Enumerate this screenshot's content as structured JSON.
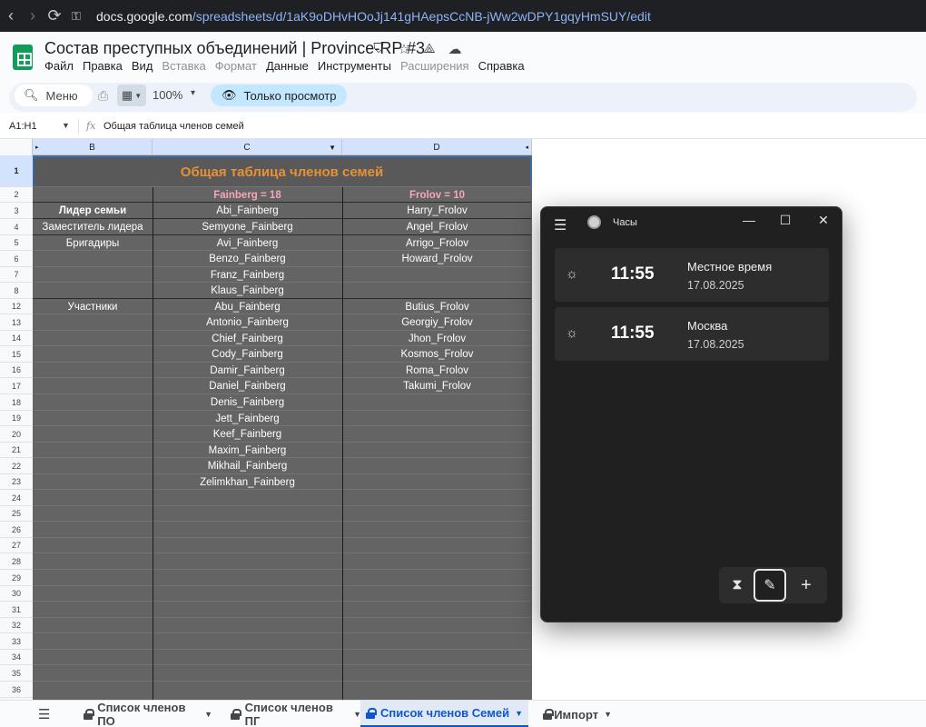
{
  "browser": {
    "url_prefix": "docs.google.com",
    "url_path": "/spreadsheets/d/1aK9oDHvHOoJj141gHAepsCcNB-jWw2wDPY1gqyHmSUY/edit"
  },
  "doc": {
    "title": "Состав преступных объединений | Province-RP #3",
    "menu": [
      {
        "label": "Файл",
        "enabled": true
      },
      {
        "label": "Правка",
        "enabled": true
      },
      {
        "label": "Вид",
        "enabled": true
      },
      {
        "label": "Вставка",
        "enabled": false
      },
      {
        "label": "Формат",
        "enabled": false
      },
      {
        "label": "Данные",
        "enabled": true
      },
      {
        "label": "Инструменты",
        "enabled": true
      },
      {
        "label": "Расширения",
        "enabled": false
      },
      {
        "label": "Справка",
        "enabled": true
      }
    ]
  },
  "toolbar": {
    "search_label": "Меню",
    "zoom": "100%",
    "view_only_label": "Только просмотр"
  },
  "formula_bar": {
    "range": "A1:H1",
    "content": "Общая таблица членов семей"
  },
  "sheet": {
    "columns": [
      "B",
      "C",
      "D"
    ],
    "row_numbers": [
      "1",
      "2",
      "3",
      "4",
      "5",
      "6",
      "7",
      "8",
      "12",
      "13",
      "14",
      "15",
      "16",
      "17",
      "18",
      "19",
      "20",
      "21",
      "22",
      "23",
      "24",
      "25",
      "26",
      "27",
      "28",
      "29",
      "30",
      "31",
      "32",
      "33",
      "34",
      "35",
      "36"
    ],
    "title": "Общая таблица членов семей",
    "family_headers": [
      "Fainberg  =  18",
      "Frolov  =  10"
    ],
    "roles": {
      "leader": "Лидер семьи",
      "deputy": "Заместитель лидера",
      "brigadiers": "Бригадиры",
      "members": "Участники"
    },
    "fainberg": [
      "Abi_Fainberg",
      "Semyone_Fainberg",
      "Avi_Fainberg",
      "Benzo_Fainberg",
      "Franz_Fainberg",
      "Klaus_Fainberg",
      "Abu_Fainberg",
      "Antonio_Fainberg",
      "Chief_Fainberg",
      "Cody_Fainberg",
      "Damir_Fainberg",
      "Daniel_Fainberg",
      "Denis_Fainberg",
      "Jett_Fainberg",
      "Keef_Fainberg",
      "Maxim_Fainberg",
      "Mikhail_Fainberg",
      "Zelimkhan_Fainberg"
    ],
    "frolov": [
      "Harry_Frolov",
      "Angel_Frolov",
      "Arrigo_Frolov",
      "Howard_Frolov",
      "",
      "",
      "Butius_Frolov",
      "Georgiy_Frolov",
      "Jhon_Frolov",
      "Kosmos_Frolov",
      "Roma_Frolov",
      "Takumi_Frolov"
    ]
  },
  "tabs": [
    {
      "label": "Список членов ПО",
      "active": false
    },
    {
      "label": "Список членов ПГ",
      "active": false
    },
    {
      "label": "Список членов Семей",
      "active": true
    },
    {
      "label": "Импорт",
      "active": false
    }
  ],
  "clock_app": {
    "title": "Часы",
    "clocks": [
      {
        "time": "11:55",
        "name": "Местное время",
        "date": "17.08.2025"
      },
      {
        "time": "11:55",
        "name": "Москва",
        "date": "17.08.2025"
      }
    ]
  },
  "colors": {
    "sheet_bg": "#646464",
    "title_text": "#e69138",
    "family_header_text": "#f4a7b9",
    "active_tab": "#0b57d0"
  }
}
